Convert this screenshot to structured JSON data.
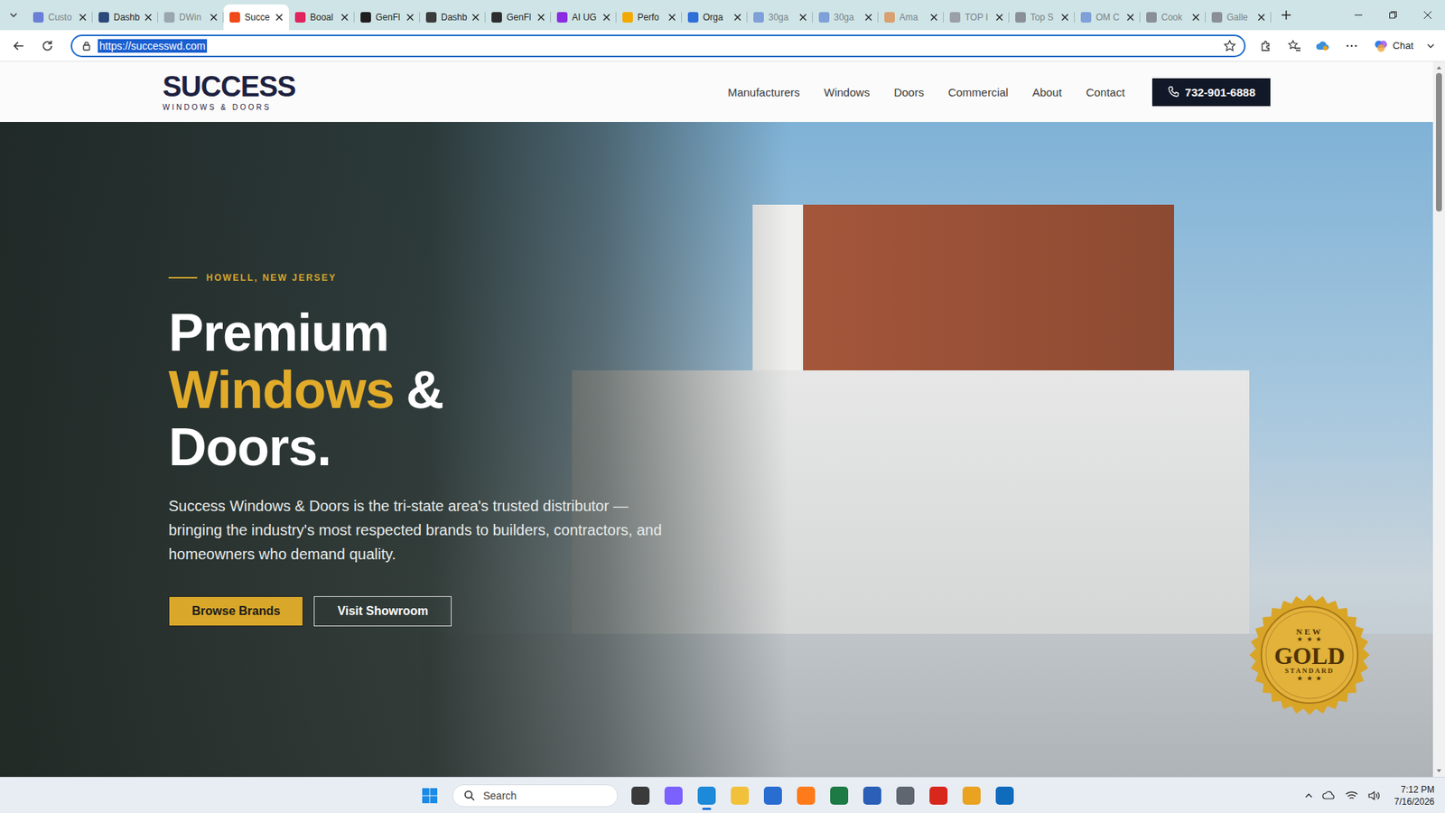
{
  "browser": {
    "tabs": [
      {
        "label": "Custo",
        "selected": false,
        "dimmed": true,
        "color": "#6b7fd6"
      },
      {
        "label": "Dashb",
        "selected": false,
        "dimmed": false,
        "color": "#2b4a7a"
      },
      {
        "label": "DWin",
        "selected": false,
        "dimmed": true,
        "color": "#9aa7b0"
      },
      {
        "label": "Succe",
        "selected": true,
        "dimmed": false,
        "color": "#f04a1a"
      },
      {
        "label": "Booal",
        "selected": false,
        "dimmed": false,
        "color": "#e0245e"
      },
      {
        "label": "GenFl",
        "selected": false,
        "dimmed": false,
        "color": "#1f1f1f"
      },
      {
        "label": "Dashb",
        "selected": false,
        "dimmed": false,
        "color": "#3b3b3b"
      },
      {
        "label": "GenFl",
        "selected": false,
        "dimmed": false,
        "color": "#2d2d2d"
      },
      {
        "label": "AI UG",
        "selected": false,
        "dimmed": false,
        "color": "#8b2be2"
      },
      {
        "label": "Perfo",
        "selected": false,
        "dimmed": false,
        "color": "#f2a900"
      },
      {
        "label": "Orga",
        "selected": false,
        "dimmed": false,
        "color": "#2f6fd8"
      },
      {
        "label": "30ga",
        "selected": false,
        "dimmed": true,
        "color": "#7fa0d8"
      },
      {
        "label": "30ga",
        "selected": false,
        "dimmed": true,
        "color": "#7fa0d8"
      },
      {
        "label": "Ama",
        "selected": false,
        "dimmed": true,
        "color": "#d9a070"
      },
      {
        "label": "TOP I",
        "selected": false,
        "dimmed": true,
        "color": "#9aa0a6"
      },
      {
        "label": "Top S",
        "selected": false,
        "dimmed": true,
        "color": "#8a9096"
      },
      {
        "label": "OM C",
        "selected": false,
        "dimmed": true,
        "color": "#7fa0d8"
      },
      {
        "label": "Cook",
        "selected": false,
        "dimmed": true,
        "color": "#8a9096"
      },
      {
        "label": "Galle",
        "selected": false,
        "dimmed": true,
        "color": "#8a9096"
      }
    ],
    "address": {
      "url": "https://successwd.com",
      "selected": true
    },
    "chat_label": "Chat"
  },
  "site": {
    "logo": {
      "name": "SUCCESS",
      "tagline": "WINDOWS & DOORS"
    },
    "nav": [
      "Manufacturers",
      "Windows",
      "Doors",
      "Commercial",
      "About",
      "Contact"
    ],
    "phone": "732-901-6888",
    "hero": {
      "eyebrow": "HOWELL, NEW JERSEY",
      "title_lines": [
        [
          {
            "text": "Premium",
            "accent": false
          }
        ],
        [
          {
            "text": "Windows",
            "accent": true
          },
          {
            "text": "&",
            "accent": false
          }
        ],
        [
          {
            "text": "Doors.",
            "accent": false
          }
        ]
      ],
      "description": "Success Windows & Doors is the tri-state area's trusted distributor — bringing the industry's most respected brands to builders, contractors, and homeowners who demand quality.",
      "buttons": [
        {
          "label": "Browse Brands",
          "kind": "primary"
        },
        {
          "label": "Visit Showroom",
          "kind": "outline"
        }
      ],
      "badge": {
        "top": "NEW",
        "stars_top": "★ ★ ★",
        "main": "GOLD",
        "bottom": "STANDARD",
        "stars_bottom": "★ ★ ★"
      }
    }
  },
  "scrollbar": {
    "level": 0.2
  },
  "taskbar": {
    "search_placeholder": "Search",
    "apps": [
      {
        "color": "#3a3a3a",
        "active": false
      },
      {
        "color": "#7b61ff",
        "active": false
      },
      {
        "color": "#1c8ad8",
        "active": true
      },
      {
        "color": "#f2c13b",
        "active": false
      },
      {
        "color": "#2a6dd1",
        "active": false
      },
      {
        "color": "#ff7a1a",
        "active": false
      },
      {
        "color": "#1d7a45",
        "active": false
      },
      {
        "color": "#2b5fb8",
        "active": false
      },
      {
        "color": "#5f6670",
        "active": false
      },
      {
        "color": "#d8281c",
        "active": false
      },
      {
        "color": "#e9a321",
        "active": false
      },
      {
        "color": "#0f6cbd",
        "active": false
      }
    ],
    "time": "7:12 PM",
    "date": "7/16/2026"
  }
}
